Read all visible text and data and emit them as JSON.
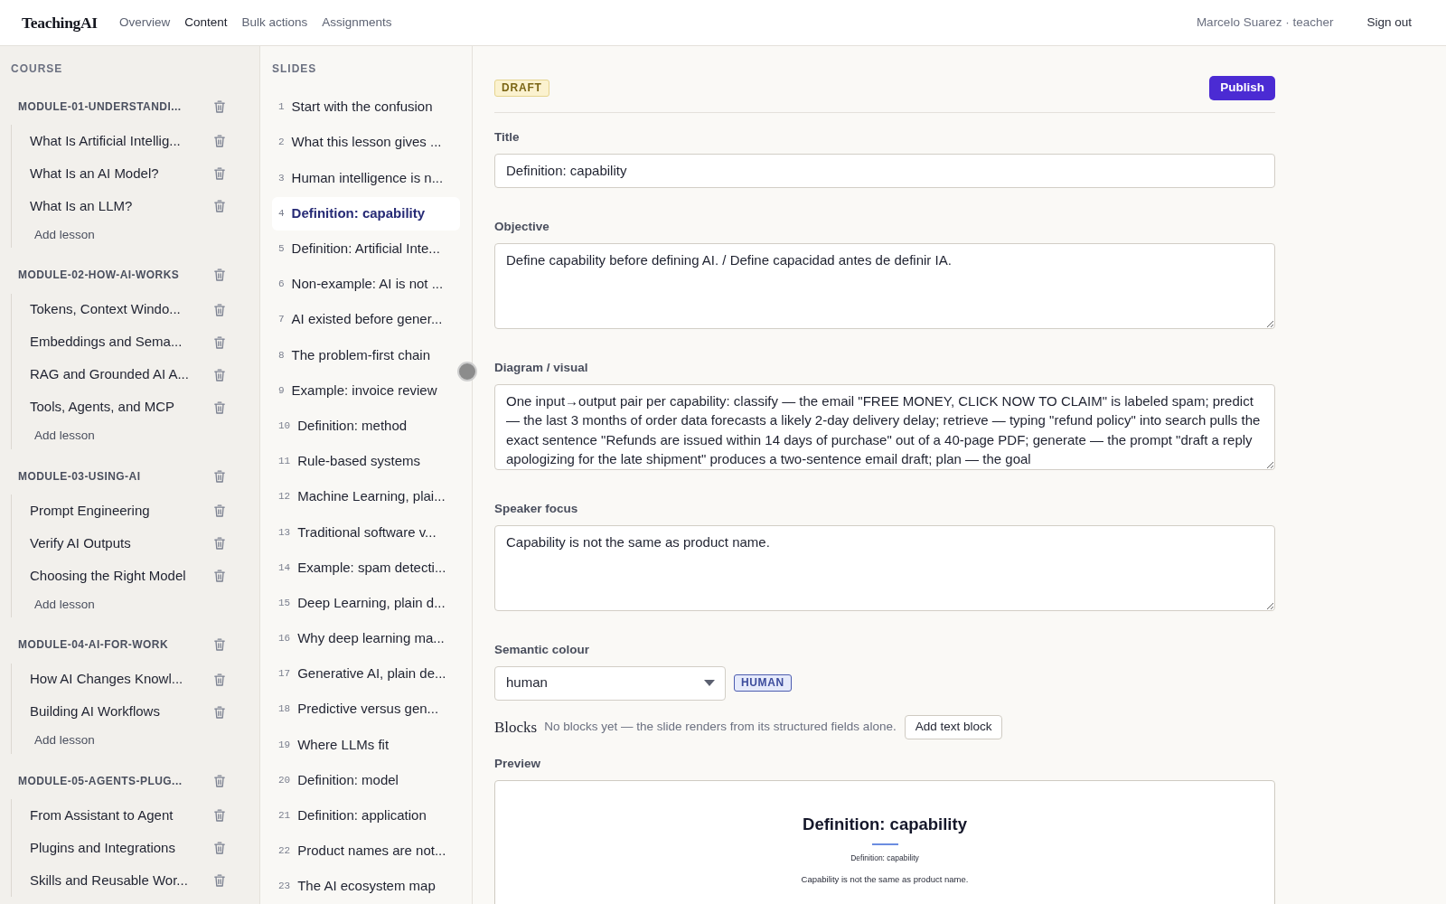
{
  "navbar": {
    "brand": "TeachingAI",
    "links": [
      {
        "label": "Overview",
        "selected": false
      },
      {
        "label": "Content",
        "selected": true
      },
      {
        "label": "Bulk actions",
        "selected": false
      },
      {
        "label": "Assignments",
        "selected": false
      }
    ],
    "user": "Marcelo Suarez · teacher",
    "sign_out": "Sign out"
  },
  "course": {
    "heading": "COURSE",
    "modules": [
      {
        "title": "MODULE-01-UNDERSTANDI...",
        "lessons": [
          "What Is Artificial Intellig...",
          "What Is an AI Model?",
          "What Is an LLM?"
        ],
        "add_label": "Add lesson"
      },
      {
        "title": "MODULE-02-HOW-AI-WORKS",
        "lessons": [
          "Tokens, Context Windo...",
          "Embeddings and Sema...",
          "RAG and Grounded AI A...",
          "Tools, Agents, and MCP"
        ],
        "add_label": "Add lesson"
      },
      {
        "title": "MODULE-03-USING-AI",
        "lessons": [
          "Prompt Engineering",
          "Verify AI Outputs",
          "Choosing the Right Model"
        ],
        "add_label": "Add lesson"
      },
      {
        "title": "MODULE-04-AI-FOR-WORK",
        "lessons": [
          "How AI Changes Knowl...",
          "Building AI Workflows"
        ],
        "add_label": "Add lesson"
      },
      {
        "title": "MODULE-05-AGENTS-PLUG...",
        "lessons": [
          "From Assistant to Agent",
          "Plugins and Integrations",
          "Skills and Reusable Wor..."
        ]
      }
    ]
  },
  "slides": {
    "heading": "SLIDES",
    "items": [
      {
        "number": "1",
        "title": "Start with the confusion",
        "selected": false
      },
      {
        "number": "2",
        "title": "What this lesson gives ...",
        "selected": false
      },
      {
        "number": "3",
        "title": "Human intelligence is n...",
        "selected": false
      },
      {
        "number": "4",
        "title": "Definition: capability",
        "selected": true
      },
      {
        "number": "5",
        "title": "Definition: Artificial Inte...",
        "selected": false
      },
      {
        "number": "6",
        "title": "Non-example: AI is not ...",
        "selected": false
      },
      {
        "number": "7",
        "title": "AI existed before gener...",
        "selected": false
      },
      {
        "number": "8",
        "title": "The problem-first chain",
        "selected": false
      },
      {
        "number": "9",
        "title": "Example: invoice review",
        "selected": false
      },
      {
        "number": "10",
        "title": "Definition: method",
        "selected": false
      },
      {
        "number": "11",
        "title": "Rule-based systems",
        "selected": false
      },
      {
        "number": "12",
        "title": "Machine Learning, plai...",
        "selected": false
      },
      {
        "number": "13",
        "title": "Traditional software v...",
        "selected": false
      },
      {
        "number": "14",
        "title": "Example: spam detecti...",
        "selected": false
      },
      {
        "number": "15",
        "title": "Deep Learning, plain d...",
        "selected": false
      },
      {
        "number": "16",
        "title": "Why deep learning ma...",
        "selected": false
      },
      {
        "number": "17",
        "title": "Generative AI, plain de...",
        "selected": false
      },
      {
        "number": "18",
        "title": "Predictive versus gen...",
        "selected": false
      },
      {
        "number": "19",
        "title": "Where LLMs fit",
        "selected": false
      },
      {
        "number": "20",
        "title": "Definition: model",
        "selected": false
      },
      {
        "number": "21",
        "title": "Definition: application",
        "selected": false
      },
      {
        "number": "22",
        "title": "Product names are not...",
        "selected": false
      },
      {
        "number": "23",
        "title": "The AI ecosystem map",
        "selected": false
      }
    ]
  },
  "editor": {
    "status": "DRAFT",
    "publish": "Publish",
    "fields": [
      {
        "kind": "input",
        "label": "Title",
        "value": "Definition: capability"
      },
      {
        "kind": "textarea",
        "label": "Objective",
        "value": "Define capability before defining AI. / Define capacidad antes de definir IA."
      },
      {
        "kind": "textarea",
        "label": "Diagram / visual",
        "value": "One input→output pair per capability: classify — the email \"FREE MONEY, CLICK NOW TO CLAIM\" is labeled spam; predict — the last 3 months of order data forecasts a likely 2-day delivery delay; retrieve — typing \"refund policy\" into search pulls the exact sentence \"Refunds are issued within 14 days of purchase\" out of a 40-page PDF; generate — the prompt \"draft a reply apologizing for the late shipment\" produces a two-sentence email draft; plan — the goal"
      },
      {
        "kind": "textarea",
        "label": "Speaker focus",
        "value": "Capability is not the same as product name."
      }
    ],
    "semantic_colour": {
      "label": "Semantic colour",
      "value": "human",
      "tag": "HUMAN"
    },
    "blocks": {
      "heading": "Blocks",
      "hint": "No blocks yet — the slide renders from its structured fields alone.",
      "button": "Add text block"
    },
    "preview": {
      "label": "Preview",
      "title": "Definition: capability",
      "subtitle": "Definition: capability",
      "body": "Capability is not the same as product name."
    }
  }
}
